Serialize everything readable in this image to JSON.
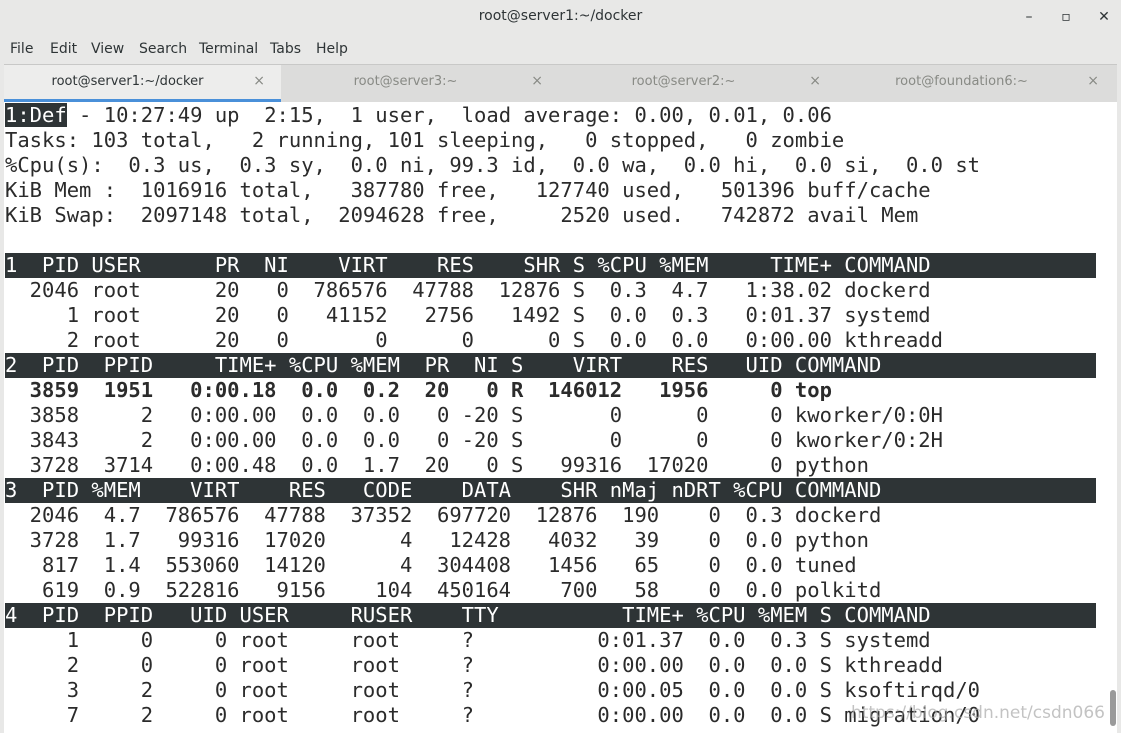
{
  "window": {
    "title": "root@server1:~/docker",
    "controls": {
      "minimize": "–",
      "maximize": "▫",
      "close": "✕"
    }
  },
  "menu": [
    "File",
    "Edit",
    "View",
    "Search",
    "Terminal",
    "Tabs",
    "Help"
  ],
  "tabs": [
    {
      "label": "root@server1:~/docker",
      "active": true
    },
    {
      "label": "root@server3:~",
      "active": false
    },
    {
      "label": "root@server2:~",
      "active": false
    },
    {
      "label": "root@foundation6:~",
      "active": false
    }
  ],
  "tab_close_glyph": "×",
  "terminal": {
    "cursor_text": "1:Def",
    "summary_rest": " - 10:27:49 up  2:15,  1 user,  load average: 0.00, 0.01, 0.06",
    "tasks_line": "Tasks: 103 total,   2 running, 101 sleeping,   0 stopped,   0 zombie",
    "cpu_line": "%Cpu(s):  0.3 us,  0.3 sy,  0.0 ni, 99.3 id,  0.0 wa,  0.0 hi,  0.0 si,  0.0 st",
    "mem_line": "KiB Mem :  1016916 total,   387780 free,   127740 used,   501396 buff/cache",
    "swap_line": "KiB Swap:  2097148 total,  2094628 free,     2520 used.   742872 avail Mem",
    "blank": " ",
    "window1": {
      "header": "1  PID USER      PR  NI    VIRT    RES    SHR S %CPU %MEM     TIME+ COMMAND",
      "rows": [
        "  2046 root      20   0  786576  47788  12876 S  0.3  4.7   1:38.02 dockerd",
        "     1 root      20   0   41152   2756   1492 S  0.0  0.3   0:01.37 systemd",
        "     2 root      20   0       0      0      0 S  0.0  0.0   0:00.00 kthreadd"
      ]
    },
    "window2": {
      "header": "2  PID  PPID     TIME+ %CPU %MEM  PR  NI S    VIRT    RES   UID COMMAND",
      "rows": [
        {
          "text": "  3859  1951   0:00.18  0.0  0.2  20   0 R  146012   1956     0 top",
          "bold": true
        },
        {
          "text": "  3858     2   0:00.00  0.0  0.0   0 -20 S       0      0     0 kworker/0:0H",
          "bold": false
        },
        {
          "text": "  3843     2   0:00.00  0.0  0.0   0 -20 S       0      0     0 kworker/0:2H",
          "bold": false
        },
        {
          "text": "  3728  3714   0:00.48  0.0  1.7  20   0 S   99316  17020     0 python",
          "bold": false
        }
      ]
    },
    "window3": {
      "header": "3  PID %MEM    VIRT    RES   CODE    DATA    SHR nMaj nDRT %CPU COMMAND",
      "rows": [
        "  2046  4.7  786576  47788  37352  697720  12876  190    0  0.3 dockerd",
        "  3728  1.7   99316  17020      4   12428   4032   39    0  0.0 python",
        "   817  1.4  553060  14120      4  304408   1456   65    0  0.0 tuned",
        "   619  0.9  522816   9156    104  450164    700   58    0  0.0 polkitd"
      ]
    },
    "window4": {
      "header": "4  PID  PPID   UID USER     RUSER    TTY          TIME+ %CPU %MEM S COMMAND",
      "rows": [
        "     1     0     0 root     root     ?          0:01.37  0.0  0.3 S systemd",
        "     2     0     0 root     root     ?          0:00.00  0.0  0.0 S kthreadd",
        "     3     2     0 root     root     ?          0:00.05  0.0  0.0 S ksoftirqd/0",
        "     7     2     0 root     root     ?          0:00.00  0.0  0.0 S migration/0"
      ]
    }
  },
  "watermark": "https://blog.csdn.net/csdn066"
}
